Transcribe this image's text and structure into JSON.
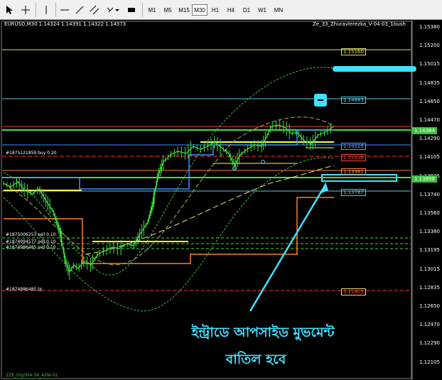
{
  "toolbar": {
    "cursor_icon": "cursor-arrow-icon",
    "crosshair_icon": "crosshair-icon",
    "vline_icon": "vertical-line-icon",
    "hline_icon": "horizontal-line-icon",
    "trendline_icon": "trendline-icon",
    "channel_icon": "channels-icon",
    "text_icon": "text-tool-icon",
    "shapes_icon": "shapes-icon",
    "timeframes": [
      "M1",
      "M5",
      "M15",
      "M30",
      "H1",
      "H4",
      "D1",
      "W1",
      "MN"
    ],
    "active_timeframe": "M30"
  },
  "chart_header": {
    "symbol_info": "EURUSD,M30  1.14324 1.14391 1.14322 1.14373",
    "indicator_name": "Ze_33_Zhuravlerezka_V-04-03_1bush"
  },
  "price_axis": [
    "1.15380",
    "1.15200",
    "1.15015",
    "1.14835",
    "1.14650",
    "1.14470",
    "1.14290",
    "1.14105",
    "1.13925",
    "1.13740",
    "1.13560",
    "1.13380",
    "1.13195",
    "1.13015",
    "1.12835",
    "1.12650",
    "1.12470",
    "1.12290",
    "1.12105"
  ],
  "level_labels": [
    {
      "text": "1.15160",
      "color": "#e8e070",
      "border": "#e8e070"
    },
    {
      "text": "1.14683",
      "color": "#60c8e0",
      "border": "#60c8e0"
    },
    {
      "text": "1.14384",
      "color": "#ffffff",
      "border": "#40c040",
      "bg": "#40c040"
    },
    {
      "text": "1.14225",
      "color": "#60a0ff",
      "border": "#60a0ff"
    },
    {
      "text": "1.14138",
      "color": "#ff4040",
      "border": "#ff4040"
    },
    {
      "text": "1.13981",
      "color": "#ff8040",
      "border": "#ff8040"
    },
    {
      "text": "1.13898",
      "color": "#ffffff",
      "border": "#40c040",
      "bg": "#40c040"
    },
    {
      "text": "1.13767",
      "color": "#60c8e0",
      "border": "#60c8e0"
    },
    {
      "text": "1.12803",
      "color": "#ff4040",
      "border": "#e8e070"
    }
  ],
  "orders": [
    {
      "text": "#1875121859 buy 0.20"
    },
    {
      "text": "#1875006253 sell 0.10"
    },
    {
      "text": "#1874994577 sell 0.10"
    },
    {
      "text": "#1874986485 sell 0.10"
    },
    {
      "text": "#1874986485 tp"
    }
  ],
  "annotation": {
    "line1": "ইন্ট্রাডে আপসাইড মুভমেন্ট",
    "line2": "বাতিল হবে"
  },
  "footer": "ZZE_Glg3H4-56_4/06-02",
  "colors": {
    "green": "#40e040",
    "cyan_marker": "#40e0ff",
    "orange": "#ff8020",
    "blue": "#4090ff",
    "red": "#ff3030",
    "yellow": "#ffff40"
  }
}
